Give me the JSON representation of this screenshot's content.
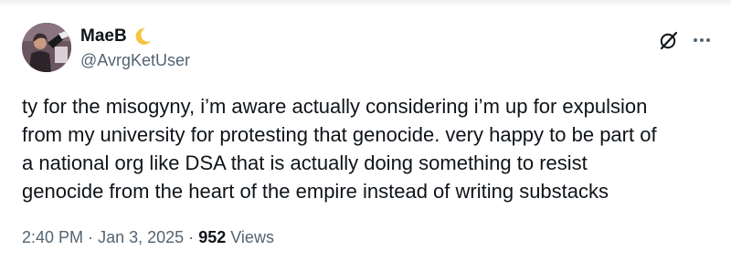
{
  "author": {
    "display_name": "MaeB",
    "handle": "@AvrgKetUser",
    "badge_icon": "crescent-moon-icon",
    "badge_color": "#f5c542"
  },
  "actions": {
    "grok_icon": "grok-slash-icon",
    "more_icon": "more-dots-icon"
  },
  "tweet": {
    "text": "ty for the misogyny, i’m aware actually considering i’m up for expulsion\nfrom my university for protesting that genocide. very happy to be part of\na national org like DSA that is actually doing something to resist\ngenocide from the heart of the empire instead of writing substacks"
  },
  "meta": {
    "time": "2:40 PM",
    "separator": "·",
    "date": "Jan 3, 2025",
    "views_count": "952",
    "views_label": "Views"
  },
  "colors": {
    "text_primary": "#0f1419",
    "text_secondary": "#536471",
    "background": "#ffffff"
  }
}
